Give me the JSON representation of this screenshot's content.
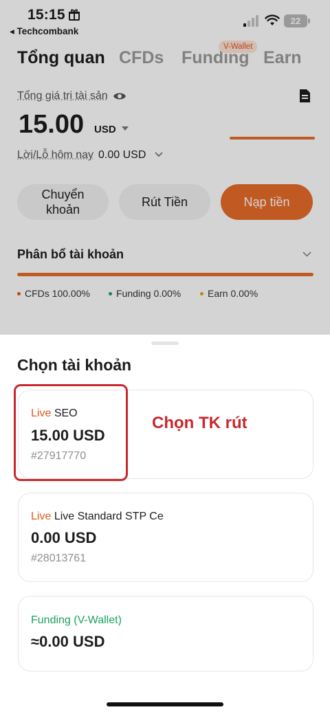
{
  "status_bar": {
    "time": "15:15",
    "back_app": "◂ Techcombank",
    "battery": "22",
    "icons": [
      "gift-icon",
      "signal-icon",
      "wifi-icon",
      "battery-icon"
    ]
  },
  "tabs": [
    {
      "label": "Tổng quan",
      "active": true
    },
    {
      "label": "CFDs",
      "active": false
    },
    {
      "label": "Funding",
      "active": false,
      "badge": "V-Wallet"
    },
    {
      "label": "Earn",
      "active": false
    }
  ],
  "overview": {
    "asset_label": "Tổng giá trị tài sản",
    "balance": "15.00",
    "currency": "USD",
    "pnl_label": "Lời/Lỗ hôm nay",
    "pnl_value": "0.00 USD"
  },
  "actions": {
    "transfer": "Chuyển\nkhoản",
    "withdraw": "Rút Tiền",
    "deposit": "Nạp tiền"
  },
  "allocation": {
    "title": "Phân bổ tài khoản",
    "legend": [
      {
        "label": "CFDs 100.00%",
        "color": "#e2561a"
      },
      {
        "label": "Funding 0.00%",
        "color": "#1aa35b"
      },
      {
        "label": "Earn 0.00%",
        "color": "#e0a21b"
      }
    ]
  },
  "sheet": {
    "title": "Chọn tài khoản",
    "annotation": "Chọn TK rút",
    "accounts": [
      {
        "type": "Live",
        "name": "SEO",
        "amount": "15.00 USD",
        "number": "#27917770"
      },
      {
        "type": "Live",
        "name": "Live Standard STP Ce",
        "amount": "0.00 USD",
        "number": "#28013761"
      },
      {
        "type": "Funding (V-Wallet)",
        "name": "",
        "amount": "≈0.00 USD",
        "number": ""
      }
    ]
  },
  "colors": {
    "accent": "#e86b2b",
    "annotation_red": "#c8282d",
    "funding_green": "#1aa35b"
  }
}
